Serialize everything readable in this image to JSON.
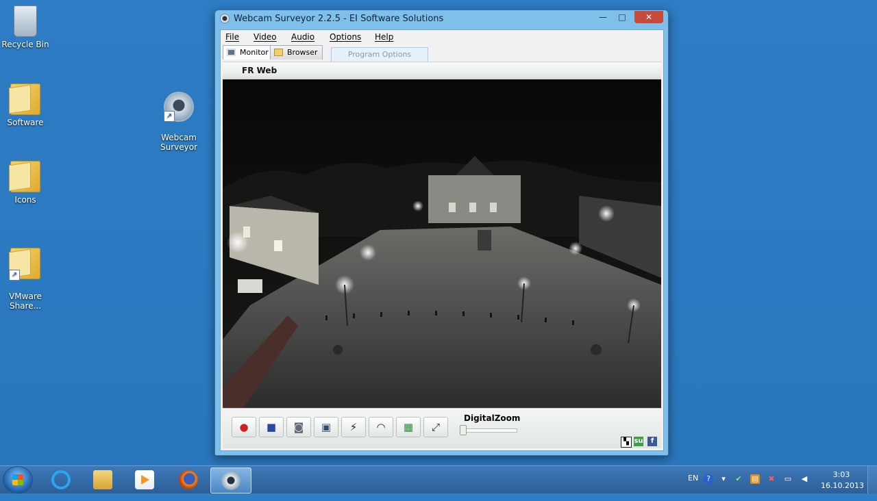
{
  "desktop": {
    "icons": [
      {
        "label": "Recycle Bin"
      },
      {
        "label": "Software"
      },
      {
        "label": "Icons"
      },
      {
        "label": "VMware\nShare..."
      },
      {
        "label": "Webcam\nSurveyor"
      }
    ]
  },
  "window": {
    "title": "Webcam Surveyor 2.2.5 - EI Software Solutions",
    "menu": [
      "File",
      "Video",
      "Audio",
      "Options",
      "Help"
    ],
    "tabs": [
      "Monitor",
      "Browser"
    ],
    "tooltip": "Program Options",
    "camera_name": "FR Web",
    "zoom_label": "DigitalZoom",
    "zoom_level": 0
  },
  "taskbar": {
    "language": "EN",
    "time": "3:03",
    "date": "16.10.2013"
  },
  "colors": {
    "desktop": "#2f7fc6",
    "window_border": "#7fc0ea",
    "close_button": "#c74a3a"
  }
}
